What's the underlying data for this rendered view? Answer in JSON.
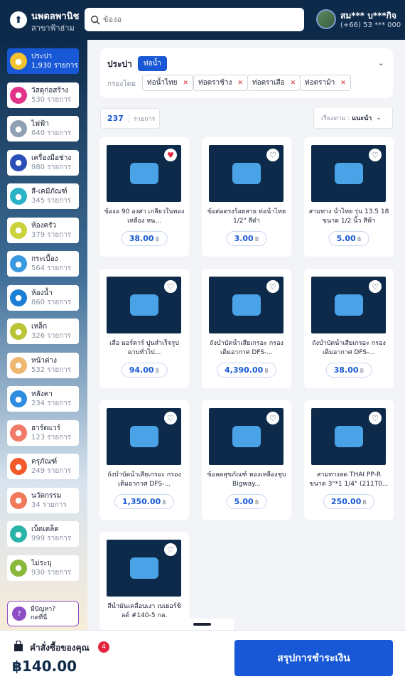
{
  "header": {
    "store_name": "นพดลพานิช",
    "branch": "สาขาฟ้าฮ่าม",
    "search_placeholder": "ข้องอ",
    "user_name": "สม*** บ***กิจ",
    "user_phone": "(+66) 53 *** 000"
  },
  "sidebar": {
    "categories": [
      {
        "label": "ประปา",
        "count": "1,930 รายการ",
        "icon": "faucet-icon",
        "color": "#f2c230",
        "active": true
      },
      {
        "label": "วัสดุก่อสร้าง",
        "count": "530 รายการ",
        "icon": "hard-hat-icon",
        "color": "#e2338a"
      },
      {
        "label": "ไฟฟ้า",
        "count": "640 รายการ",
        "icon": "electric-icon",
        "color": "#8fa0b3"
      },
      {
        "label": "เครื่องมือช่าง",
        "count": "980 รายการ",
        "icon": "tools-icon",
        "color": "#2b4fb8"
      },
      {
        "label": "สี-เคมีภัณฑ์",
        "count": "345 รายการ",
        "icon": "paint-icon",
        "color": "#2ab3c7"
      },
      {
        "label": "ห้องครัว",
        "count": "379 รายการ",
        "icon": "kitchen-icon",
        "color": "#c9d23a"
      },
      {
        "label": "กระเบื้อง",
        "count": "564 รายการ",
        "icon": "tile-icon",
        "color": "#3a9ae0"
      },
      {
        "label": "ห้องน้ำ",
        "count": "860 รายการ",
        "icon": "shower-icon",
        "color": "#1c7fd6"
      },
      {
        "label": "เหล็ก",
        "count": "326 รายการ",
        "icon": "steel-icon",
        "color": "#b9c437"
      },
      {
        "label": "หน้าต่าง",
        "count": "532 รายการ",
        "icon": "window-icon",
        "color": "#f0b770"
      },
      {
        "label": "หลังคา",
        "count": "234 รายการ",
        "icon": "roof-icon",
        "color": "#2d8de0"
      },
      {
        "label": "ฮาร์ดแวร์",
        "count": "123 รายการ",
        "icon": "hardware-icon",
        "color": "#f27a6a"
      },
      {
        "label": "ครุภัณฑ์",
        "count": "249 รายการ",
        "icon": "equipment-icon",
        "color": "#f25a2a"
      },
      {
        "label": "นวัตกรรม",
        "count": "34 รายการ",
        "icon": "innovation-icon",
        "color": "#f07a5a"
      },
      {
        "label": "เบ็ดเตล็ด",
        "count": "999 รายการ",
        "icon": "misc-icon",
        "color": "#2ab3a7"
      },
      {
        "label": "ไม่ระบุ",
        "count": "930 รายการ",
        "icon": "unspecified-icon",
        "color": "#8ab83a"
      }
    ],
    "help": {
      "line1": "มีปัญหา?",
      "line2": "กดที่นี่"
    }
  },
  "filter": {
    "category": "ประปา",
    "subcategory": "ท่อน้ำ",
    "filter_label": "กรองโดย",
    "chips": [
      "ท่อน้ำไทย",
      "ท่อตราช้าง",
      "ท่อตราเสือ",
      "ท่อตราม้า"
    ]
  },
  "results": {
    "count": "237",
    "unit": "รายการ",
    "sort_label": "เรียงตาม :",
    "sort_value": "แนะนำ"
  },
  "products": [
    {
      "title": "ข้องอ 90 องศา เกลียวในทองเหลือง หน...",
      "price": "38.00",
      "currency": "฿",
      "favorite": true,
      "icon": "elbow-pipe-icon"
    },
    {
      "title": "ข้อต่อตรงร้อยสาย ท่อน้ำไทย 1/2\" สีดำ",
      "price": "3.00",
      "currency": "฿",
      "favorite": false,
      "icon": "coupling-icon"
    },
    {
      "title": "สามทาง น้ำไทย รุ่น 13.5 18 ขนาด 1/2 นิ้ว สีฟ้า",
      "price": "5.00",
      "currency": "฿",
      "favorite": false,
      "icon": "tee-pipe-icon"
    },
    {
      "title": "เสือ มอร์ตาร์ ปูนสำเร็จรูปฉาบทั่วไป...",
      "price": "94.00",
      "currency": "฿",
      "favorite": false,
      "icon": "mortar-bag-icon"
    },
    {
      "title": "ถังบำบัดน้ำเสียเกรอะ กรองเติมอากาศ DFS-...",
      "price": "4,390.00",
      "currency": "฿",
      "favorite": false,
      "icon": "septic-tank-icon"
    },
    {
      "title": "ถังบำบัดน้ำเสียเกรอะ กรองเติมอากาศ DFS-...",
      "price": "38.00",
      "currency": "฿",
      "favorite": false,
      "icon": "clamp-icon"
    },
    {
      "title": "ถังบำบัดน้ำเสียเกรอะ กรองเติมอากาศ DFS-...",
      "price": "1,350.00",
      "currency": "฿",
      "favorite": false,
      "icon": "paint-bucket-icon"
    },
    {
      "title": "ข้อลดสุขภัณฑ์ ทองเหลืองชุบ Bigway...",
      "price": "5.00",
      "currency": "฿",
      "favorite": false,
      "icon": "reducer-icon"
    },
    {
      "title": "สามทางลด THAI PP-R ขนาด 3\"*1 1/4\" (211T0...",
      "price": "250.00",
      "currency": "฿",
      "favorite": false,
      "icon": "green-tee-icon"
    },
    {
      "title": "สีน้ำมันเคลือบเงา เบเยอร์ชิลด์ #140-5 กล.",
      "price": "",
      "currency": "",
      "favorite": false,
      "icon": "paint-can-icon"
    }
  ],
  "cart": {
    "label": "คำสั่งซื้อของคุณ",
    "badge": "4",
    "total": "฿140.00",
    "checkout": "สรุปการชำระเงิน"
  }
}
